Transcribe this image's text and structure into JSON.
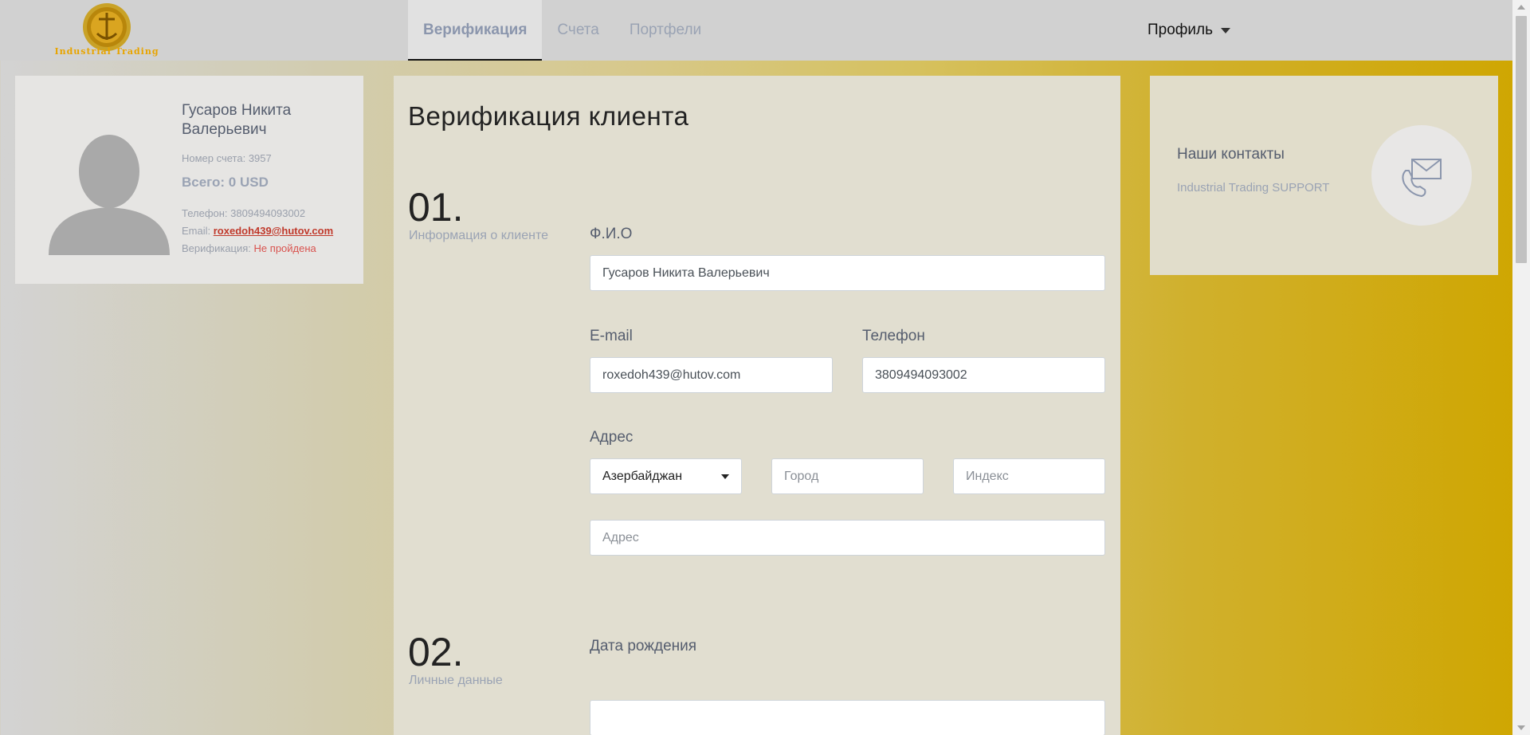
{
  "header": {
    "logo_text": "Industrial Trading",
    "tabs": [
      {
        "label": "Верификация",
        "active": true
      },
      {
        "label": "Счета",
        "active": false
      },
      {
        "label": "Портфели",
        "active": false
      }
    ],
    "profile_label": "Профиль"
  },
  "user_card": {
    "name": "Гусаров Никита Валерьевич",
    "account_label": "Номер счета: 3957",
    "total_label": "Всего: 0 USD",
    "phone_label": "Телефон: 3809494093002",
    "email_prefix": "Email:",
    "email": "roxedoh439@hutov.com",
    "verification_prefix": "Верификация:",
    "verification_status": "Не пройдена"
  },
  "form": {
    "title": "Верификация клиента",
    "step1": {
      "number": "01.",
      "label": "Информация о клиенте",
      "fio_label": "Ф.И.О",
      "fio_value": "Гусаров Никита Валерьевич",
      "email_label": "E-mail",
      "email_value": "roxedoh439@hutov.com",
      "phone_label": "Телефон",
      "phone_value": "3809494093002",
      "address_label": "Адрес",
      "country_value": "Азербайджан",
      "city_placeholder": "Город",
      "index_placeholder": "Индекс",
      "address_placeholder": "Адрес"
    },
    "step2": {
      "number": "02.",
      "label": "Личные данные",
      "birthdate_label": "Дата рождения",
      "birthdate_value": ""
    }
  },
  "contacts": {
    "title": "Наши контакты",
    "subtitle": "Industrial Trading SUPPORT"
  },
  "colors": {
    "accent_gold": "#cfa600",
    "tab_text": "#9aa3b4",
    "status_red": "#d9534f"
  },
  "icons": [
    "logo-emblem",
    "avatar-placeholder",
    "mail-phone-icon",
    "chevron-down-icon"
  ]
}
